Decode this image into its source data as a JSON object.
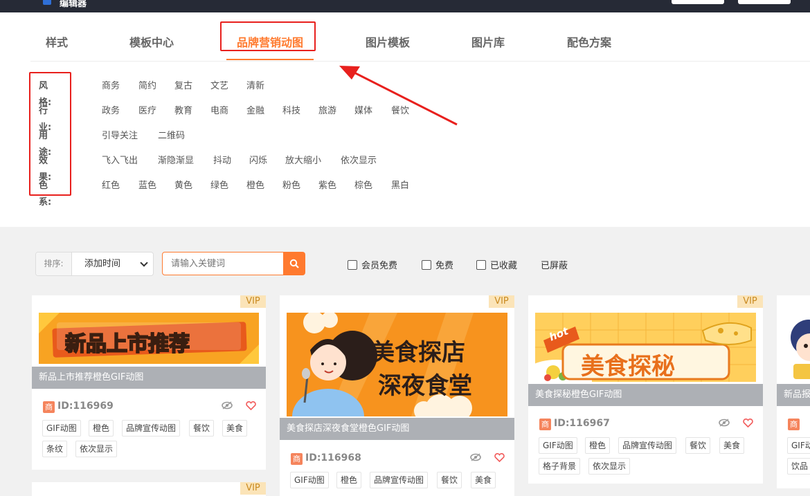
{
  "header": {
    "logo_text": "编辑器"
  },
  "tabs": [
    {
      "label": "样式"
    },
    {
      "label": "模板中心"
    },
    {
      "label": "品牌营销动图"
    },
    {
      "label": "图片模板"
    },
    {
      "label": "图片库"
    },
    {
      "label": "配色方案"
    }
  ],
  "filters": [
    {
      "label": "风格:",
      "items": [
        "商务",
        "简约",
        "复古",
        "文艺",
        "清新"
      ]
    },
    {
      "label": "行业:",
      "items": [
        "政务",
        "医疗",
        "教育",
        "电商",
        "金融",
        "科技",
        "旅游",
        "媒体",
        "餐饮"
      ]
    },
    {
      "label": "用途:",
      "items": [
        "引导关注",
        "二维码"
      ]
    },
    {
      "label": "效果:",
      "items": [
        "飞入飞出",
        "渐隐渐显",
        "抖动",
        "闪烁",
        "放大缩小",
        "依次显示"
      ]
    },
    {
      "label": "色系:",
      "items": [
        "红色",
        "蓝色",
        "黄色",
        "绿色",
        "橙色",
        "粉色",
        "紫色",
        "棕色",
        "黑白"
      ]
    }
  ],
  "toolbar": {
    "sort_label": "排序:",
    "sort_value": "添加时间",
    "search_placeholder": "请输入关键词",
    "checkboxes": [
      "会员免费",
      "免费",
      "已收藏"
    ],
    "blocked_label": "已屏蔽"
  },
  "cards": [
    {
      "vip": "VIP",
      "thumb_text": "新品上市推荐",
      "title": "新品上市推荐橙色GIF动图",
      "shang": "商",
      "id": "ID:116969",
      "tags": [
        "GIF动图",
        "橙色",
        "品牌宣传动图",
        "餐饮",
        "美食",
        "条纹",
        "依次显示"
      ]
    },
    {
      "vip": "VIP",
      "thumb_text_1": "美食探店",
      "thumb_text_2": "深夜食堂",
      "title": "美食探店深夜食堂橙色GIF动图",
      "shang": "商",
      "id": "ID:116968",
      "tags": [
        "GIF动图",
        "橙色",
        "品牌宣传动图",
        "餐饮",
        "美食"
      ]
    },
    {
      "vip": "VIP",
      "thumb_badge": "hot",
      "thumb_text": "美食探秘",
      "title": "美食探秘橙色GIF动图",
      "shang": "商",
      "id": "ID:116967",
      "tags": [
        "GIF动图",
        "橙色",
        "品牌宣传动图",
        "餐饮",
        "美食",
        "格子背景",
        "依次显示"
      ]
    },
    {
      "title": "新品报",
      "shang": "商",
      "tags": [
        "GIF动",
        "饮品"
      ]
    },
    {
      "vip": "VIP"
    }
  ],
  "colors": {
    "accent": "#ff7a2f",
    "annotation_red": "#e8201d",
    "vip_bg": "#fbe4b8",
    "title_bar": "#adb0b5"
  }
}
